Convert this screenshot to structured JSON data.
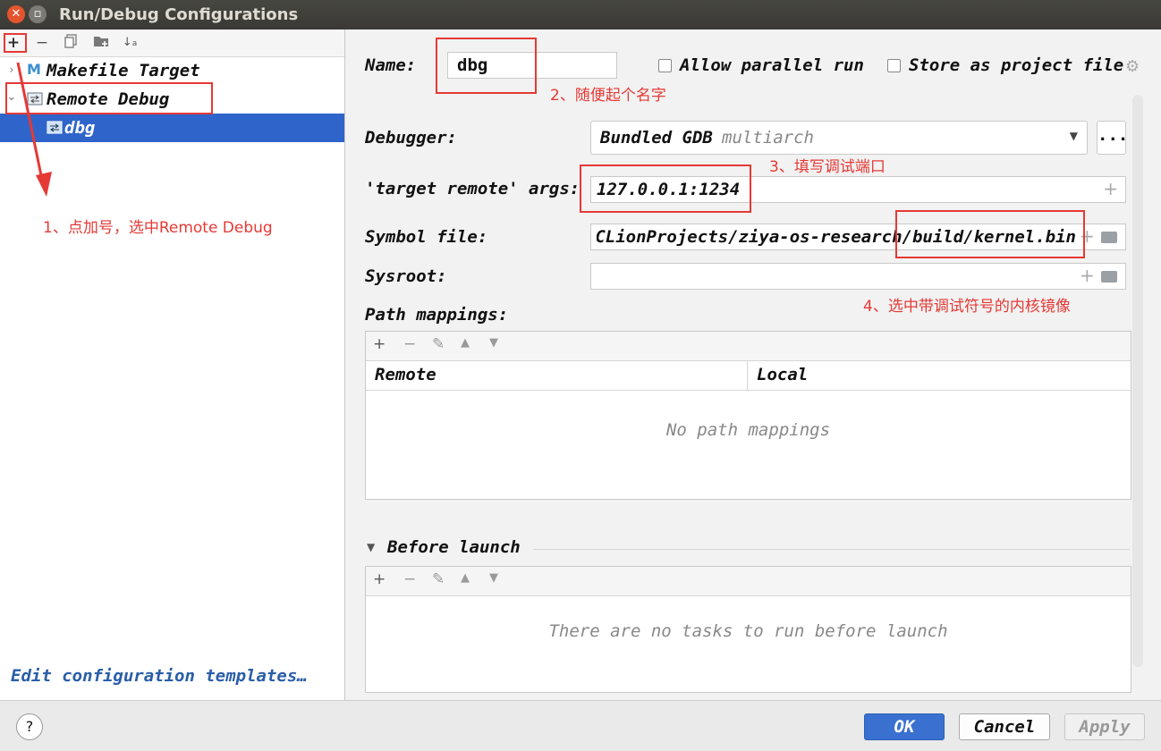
{
  "window": {
    "title": "Run/Debug Configurations"
  },
  "toolbar": {
    "add": "+",
    "remove": "−"
  },
  "tree": [
    {
      "label": "Makefile Target",
      "icon": "makefile-icon",
      "icon_glyph": "M"
    },
    {
      "label": "Remote Debug",
      "icon": "remote-debug-icon"
    },
    {
      "label": "dbg",
      "icon": "remote-debug-icon"
    }
  ],
  "edit_templates": "Edit configuration templates…",
  "form": {
    "name_label": "Name:",
    "name_value": "dbg",
    "allow_parallel": "Allow parallel run",
    "store_project": "Store as project file",
    "debugger_label": "Debugger:",
    "debugger_value": "Bundled GDB",
    "debugger_hint": "multiarch",
    "browse": "...",
    "target_label": "'target remote' args:",
    "target_value": "127.0.0.1:1234",
    "symbol_label": "Symbol file:",
    "symbol_value": "CLionProjects/ziya-os-research/build/kernel.bin",
    "sysroot_label": "Sysroot:",
    "sysroot_value": "",
    "path_mappings_label": "Path mappings:",
    "col_remote": "Remote",
    "col_local": "Local",
    "no_mappings": "No path mappings",
    "before_launch": "Before launch",
    "no_tasks": "There are no tasks to run before launch"
  },
  "buttons": {
    "ok": "OK",
    "cancel": "Cancel",
    "apply": "Apply",
    "help": "?"
  },
  "annotations": {
    "note1": "1、点加号，选中Remote Debug",
    "note2": "2、随便起个名字",
    "note3": "3、填写调试端口",
    "note4": "4、选中带调试符号的内核镜像"
  },
  "colors": {
    "selection": "#2f65ca",
    "ok_button": "#3a70d0",
    "annotation": "#e53935",
    "link": "#2a5ea8"
  }
}
